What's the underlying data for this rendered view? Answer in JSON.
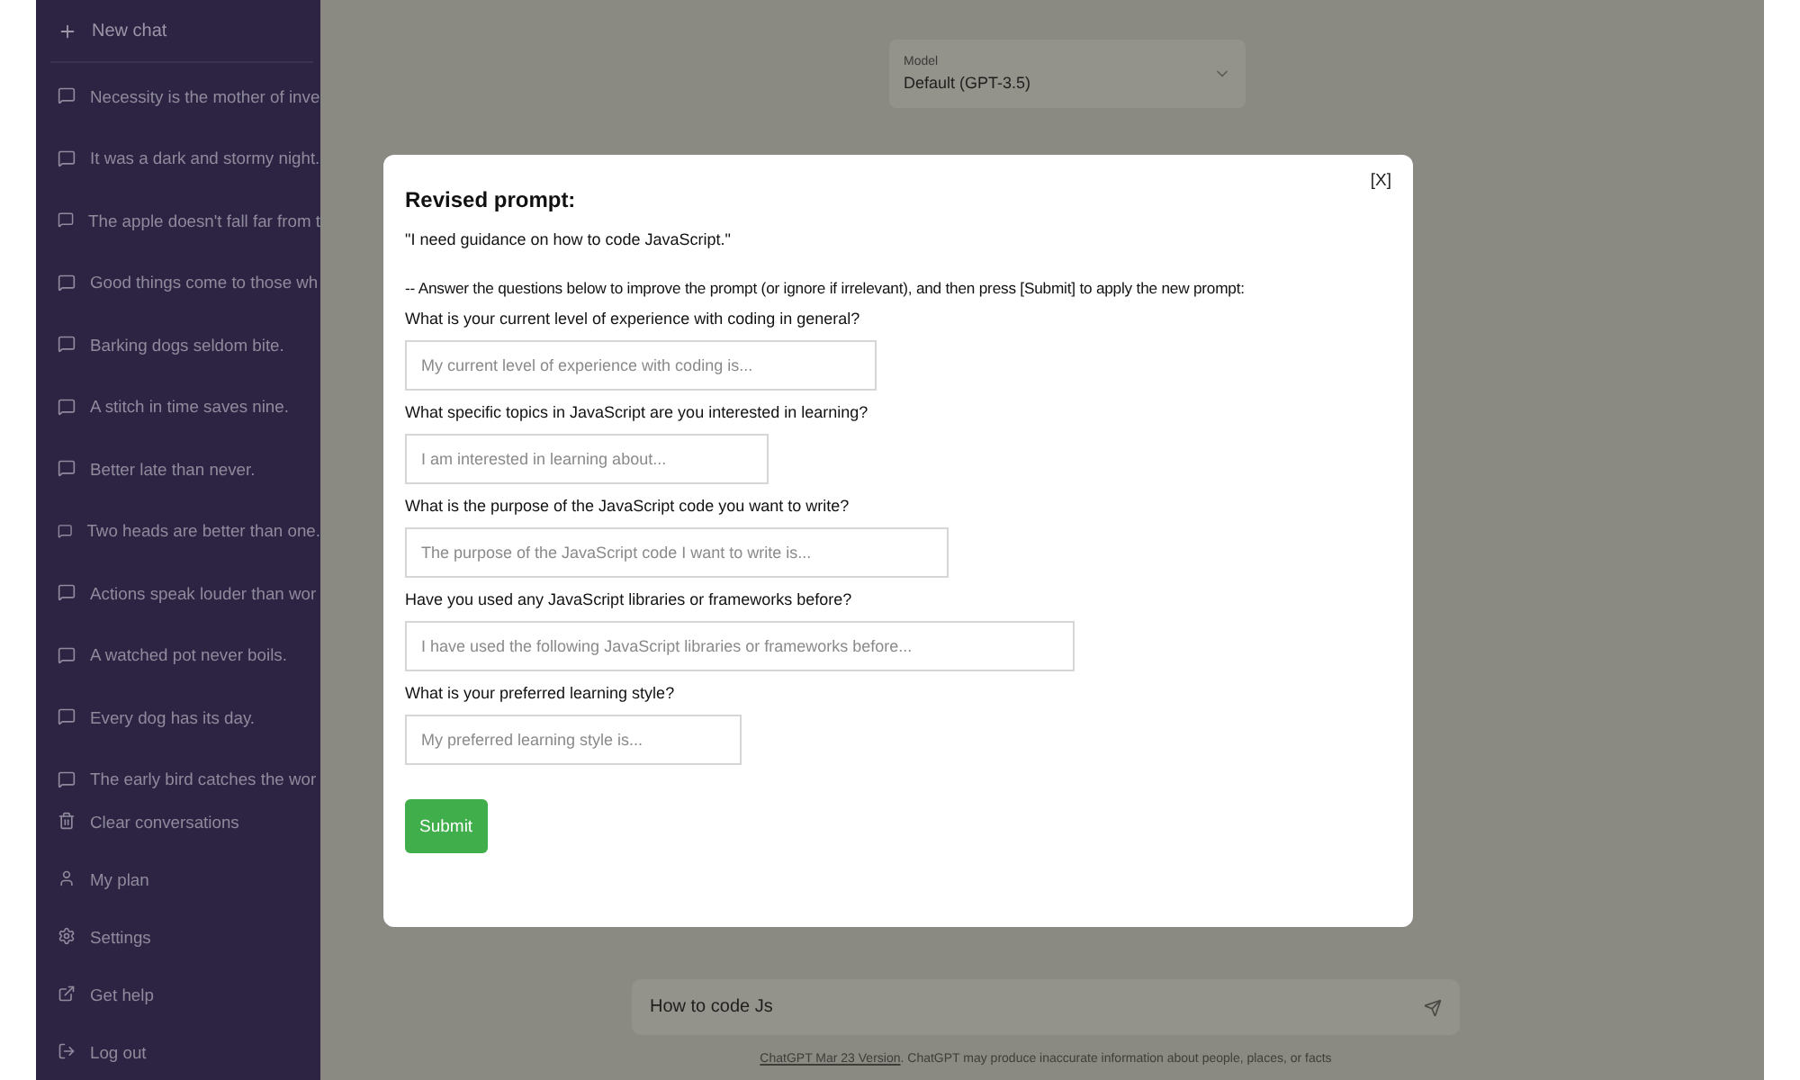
{
  "sidebar": {
    "new_chat": "New chat",
    "conversations": [
      "Necessity is the mother of inve",
      "It was a dark and stormy night.",
      "The apple doesn't fall far from t",
      "Good things come to those wh",
      "Barking dogs seldom bite.",
      "A stitch in time saves nine.",
      "Better late than never.",
      "Two heads are better than one.",
      "Actions speak louder than wor",
      "A watched pot never boils.",
      "Every dog has its day.",
      "The early bird catches the wor"
    ],
    "menu": [
      {
        "kind": "trash",
        "label": "Clear conversations"
      },
      {
        "kind": "user",
        "label": "My plan"
      },
      {
        "kind": "settings",
        "label": "Settings"
      },
      {
        "kind": "external",
        "label": "Get help"
      },
      {
        "kind": "logout",
        "label": "Log out"
      }
    ]
  },
  "model_select": {
    "label": "Model",
    "value": "Default (GPT-3.5)"
  },
  "composer": {
    "value": "How to code Js"
  },
  "footer": {
    "link": "ChatGPT Mar 23 Version",
    "text": ". ChatGPT may produce inaccurate information about people, places, or facts"
  },
  "dialog": {
    "close": "[X]",
    "title": "Revised prompt:",
    "prompt": "\"I need guidance on how to code JavaScript.\"",
    "instructions": "-- Answer the questions below to improve the prompt (or ignore if irrelevant), and then press [Submit] to apply the new prompt:",
    "questions": [
      {
        "question": "What is your current level of experience with coding in general?",
        "placeholder": "My current level of experience with coding is..."
      },
      {
        "question": "What specific topics in JavaScript are you interested in learning?",
        "placeholder": "I am interested in learning about..."
      },
      {
        "question": "What is the purpose of the JavaScript code you want to write?",
        "placeholder": "The purpose of the JavaScript code I want to write is..."
      },
      {
        "question": "Have you used any JavaScript libraries or frameworks before?",
        "placeholder": "I have used the following JavaScript libraries or frameworks before..."
      },
      {
        "question": "What is your preferred learning style?",
        "placeholder": "My preferred learning style is..."
      }
    ],
    "submit": "Submit"
  }
}
